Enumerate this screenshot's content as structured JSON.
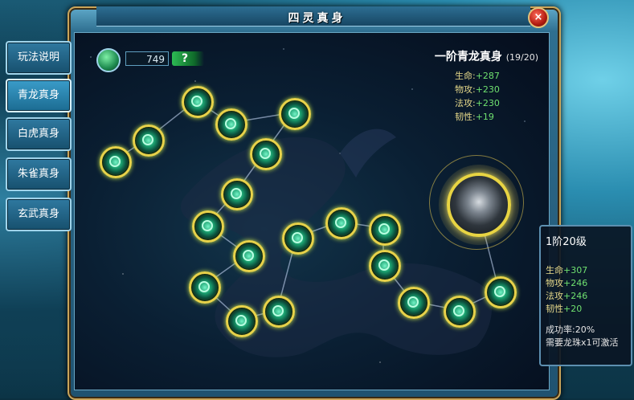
{
  "window": {
    "title": "四灵真身",
    "close_label": "×"
  },
  "side_tabs": [
    {
      "label": "玩法说明"
    },
    {
      "label": "青龙真身"
    },
    {
      "label": "白虎真身"
    },
    {
      "label": "朱雀真身"
    },
    {
      "label": "玄武真身"
    }
  ],
  "currency": {
    "count": "749",
    "help_label": "?"
  },
  "stage": {
    "title": "一阶青龙真身",
    "progress": "(19/20)",
    "stats": [
      {
        "label": "生命:",
        "value": "+287"
      },
      {
        "label": "物攻:",
        "value": "+230"
      },
      {
        "label": "法攻:",
        "value": "+230"
      },
      {
        "label": "韧性:",
        "value": "+19"
      }
    ]
  },
  "tooltip": {
    "title": "1阶20级",
    "stats": [
      {
        "label": "生命",
        "value": "+307"
      },
      {
        "label": "物攻",
        "value": "+246"
      },
      {
        "label": "法攻",
        "value": "+246"
      },
      {
        "label": "韧性",
        "value": "+20"
      }
    ],
    "success_rate": "成功率:20%",
    "requirement": "需要龙珠x1可激活"
  },
  "nodes_activated": 19,
  "nodes_total": 20
}
